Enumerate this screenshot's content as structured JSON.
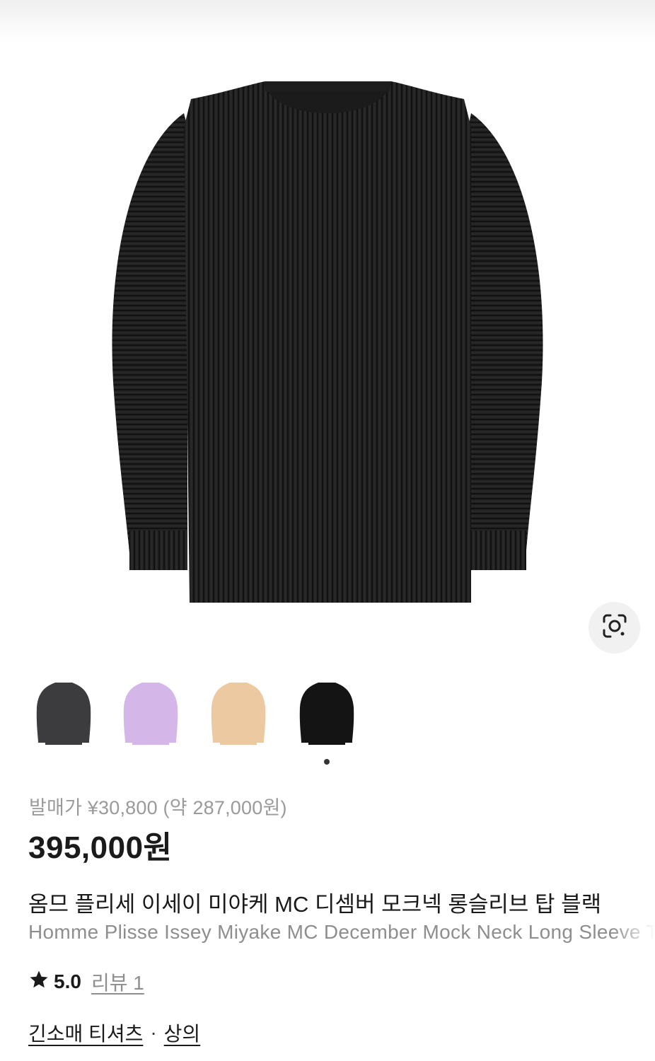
{
  "product": {
    "release_price": "발매가 ¥30,800 (약 287,000원)",
    "price": "395,000원",
    "title_ko": "옴므 플리세 이세이 미야케 MC 디셈버 모크넥 롱슬리브 탑 블랙",
    "title_en": "Homme Plisse Issey Miyake MC December Mock Neck Long Sleeve Top Black",
    "rating": "5.0",
    "reviews": "리뷰 1",
    "categories": [
      "긴소매 티셔츠",
      "상의"
    ],
    "category_separator": "·"
  },
  "colors": {
    "thumb_charcoal": "#3c3c3f",
    "thumb_lavender": "#d4b6e8",
    "thumb_beige": "#ecc9a0",
    "thumb_black": "#141414",
    "garment": "#242424"
  },
  "icons": {
    "lens": "lens-search-icon",
    "star": "star-icon"
  }
}
